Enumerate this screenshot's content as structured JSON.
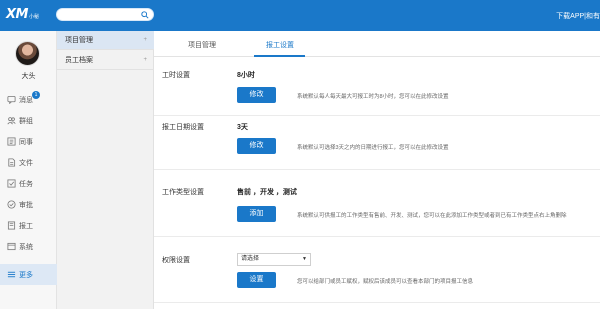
{
  "header": {
    "logo_text": "XM",
    "logo_sub": "小秘",
    "search_placeholder": "",
    "download_text": "下载APP|和有"
  },
  "leftbar": {
    "username": "大头",
    "items": [
      {
        "label": "消息",
        "icon": "message-icon",
        "badge": "1"
      },
      {
        "label": "群组",
        "icon": "group-icon"
      },
      {
        "label": "同事",
        "icon": "colleague-icon"
      },
      {
        "label": "文件",
        "icon": "file-icon"
      },
      {
        "label": "任务",
        "icon": "task-icon"
      },
      {
        "label": "审批",
        "icon": "approval-icon"
      },
      {
        "label": "报工",
        "icon": "report-icon"
      },
      {
        "label": "系统",
        "icon": "system-icon"
      },
      {
        "label": "更多",
        "icon": "more-icon"
      }
    ]
  },
  "submenu": {
    "items": [
      {
        "label": "项目管理"
      },
      {
        "label": "员工档案"
      }
    ]
  },
  "tabs": [
    {
      "label": "项目管理"
    },
    {
      "label": "报工设置"
    }
  ],
  "settings": {
    "hours": {
      "label": "工时设置",
      "value": "8小时",
      "button": "修改",
      "hint": "系统默认每人每天最大可报工时为8小时，您可以在此修改设置"
    },
    "date": {
      "label": "报工日期设置",
      "value": "3天",
      "button": "修改",
      "hint": "系统默认可选择3天之内的日期进行报工，您可以在此修改设置"
    },
    "worktype": {
      "label": "工作类型设置",
      "value": "售前 ，开发 ，测试",
      "button": "添加",
      "hint": "系统默认可供报工的工作类型有售前、开发、测试，您可以在此添加工作类型或者到已有工作类型点右上角删除"
    },
    "permission": {
      "label": "权限设置",
      "select_value": "请选择",
      "button": "设置",
      "hint": "您可以给部门或员工赋权，赋权后该成员可以查看本部门的项目报工信息"
    }
  },
  "colors": {
    "primary": "#1a78c9",
    "sidebar_bg": "#f7f7f7",
    "submenu_bg": "#f2f2f2"
  }
}
